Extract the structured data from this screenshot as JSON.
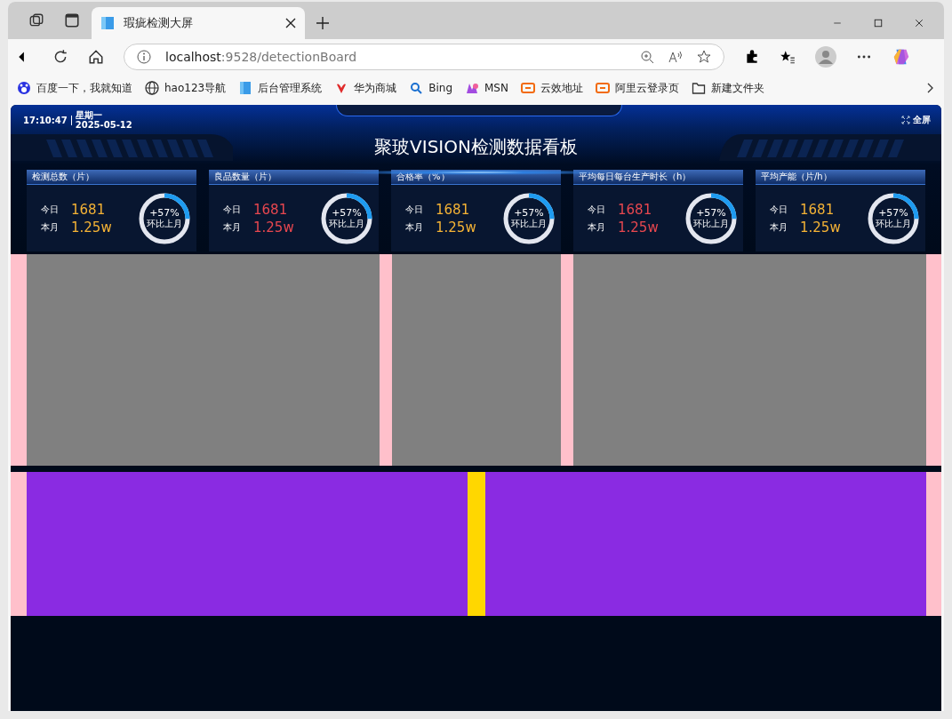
{
  "browser": {
    "tab": {
      "title": "瑕疵检测大屏",
      "selected": true
    },
    "address": {
      "host": "localhost",
      "path": ":9528/detectionBoard"
    },
    "bookmarks": [
      "百度一下，我就知道",
      "hao123导航",
      "后台管理系统",
      "华为商城",
      "Bing",
      "MSN",
      "云效地址",
      "阿里云登录页",
      "新建文件夹"
    ]
  },
  "dashboard": {
    "time": "17:10:47",
    "weekday": "星期一",
    "date": "2025-05-12",
    "title": "聚玻VISION检测数据看板",
    "fullscreen": "全屏",
    "cards": [
      {
        "title": "检测总数（片）",
        "today_label": "今日",
        "today": "1681",
        "month_label": "本月",
        "month": "1.25w",
        "color": "#f5b335",
        "ring": {
          "value": "+57%",
          "caption": "环比上月",
          "level": 0.25
        }
      },
      {
        "title": "良品数量（片）",
        "today_label": "今日",
        "today": "1681",
        "month_label": "本月",
        "month": "1.25w",
        "color": "#e8474f",
        "ring": {
          "value": "+57%",
          "caption": "环比上月",
          "level": 0.25
        }
      },
      {
        "title": "合格率（%）",
        "today_label": "今日",
        "today": "1681",
        "month_label": "本月",
        "month": "1.25w",
        "color": "#f5b335",
        "ring": {
          "value": "+57%",
          "caption": "环比上月",
          "level": 0.25
        }
      },
      {
        "title": "平均每日每台生产时长（h）",
        "today_label": "今日",
        "today": "1681",
        "month_label": "本月",
        "month": "1.25w",
        "color": "#e8474f",
        "ring": {
          "value": "+57%",
          "caption": "环比上月",
          "level": 0.25
        }
      },
      {
        "title": "平均产能（片/h）",
        "today_label": "今日",
        "today": "1681",
        "month_label": "本月",
        "month": "1.25w",
        "color": "#f5b335",
        "ring": {
          "value": "+57%",
          "caption": "环比上月",
          "level": 0.25
        }
      }
    ]
  }
}
